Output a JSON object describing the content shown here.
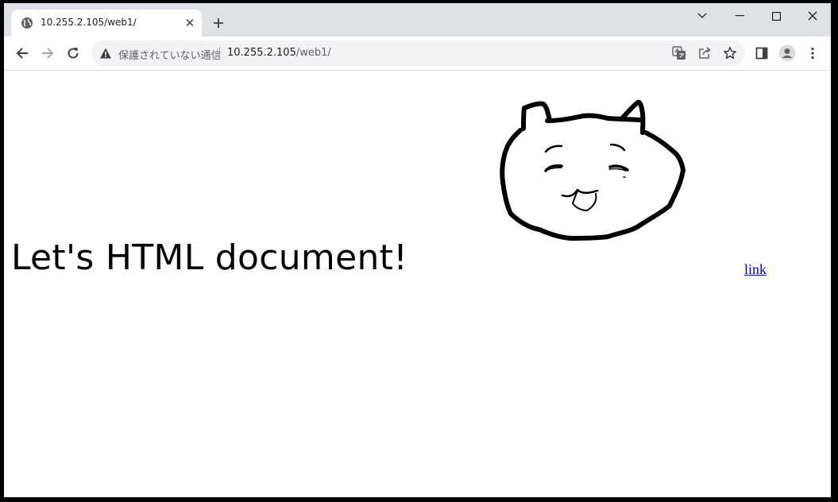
{
  "browser": {
    "tab": {
      "title": "10.255.2.105/web1/"
    },
    "address": {
      "security_label": "保護されていない通信",
      "host": "10.255.2.105",
      "path": "/web1/"
    }
  },
  "page": {
    "heading": "Let's HTML document!",
    "link_text": "link"
  },
  "colors": {
    "titlebar": "#dee1e6",
    "link": "#0000ee"
  }
}
